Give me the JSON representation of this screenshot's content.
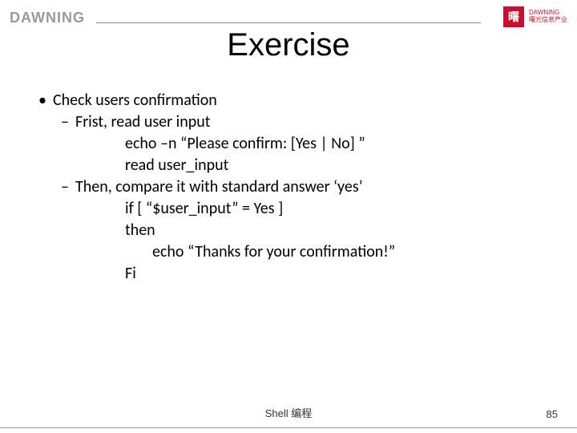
{
  "header": {
    "brand_left": "DAWNING",
    "brand_right_glyph": "曙",
    "brand_right_caption_line1": "DAWNING",
    "brand_right_caption_line2": "曙光信息产业"
  },
  "title": "Exercise",
  "content": {
    "b1": "Check users confirmation",
    "s1": "Frist, read user input",
    "c1": "echo –n “Please confirm: [Yes | No]  ”",
    "c2": "read user_input",
    "s2": "Then, compare it with standard answer ‘yes’",
    "c3": "if  [  “$user_input”  = Yes  ]",
    "c4": "then",
    "c5": "echo “Thanks for your confirmation!”",
    "c6": "Fi"
  },
  "footer": {
    "center": "Shell 编程",
    "page": "85"
  }
}
